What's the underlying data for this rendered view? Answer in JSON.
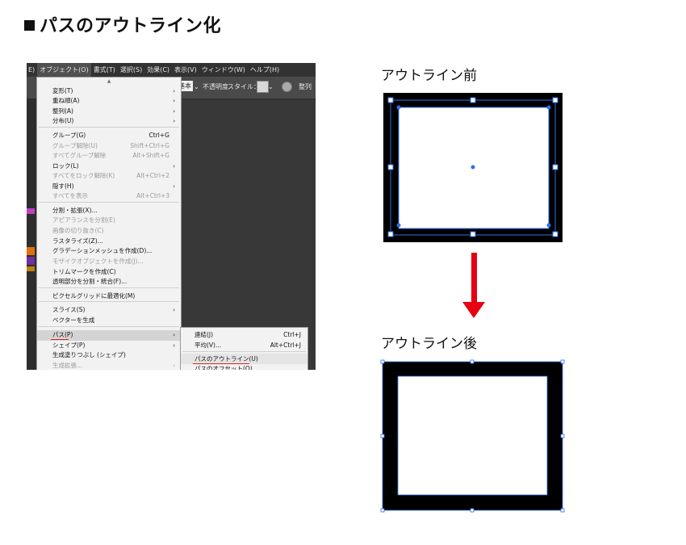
{
  "heading": "パスのアウトライン化",
  "screenshot": {
    "menubar": [
      "E)",
      "オブジェクト(O)",
      "書式(T)",
      "選択(S)",
      "効果(C)",
      "表示(V)",
      "ウィンドウ(W)",
      "ヘルプ(H)"
    ],
    "toolbar": {
      "basic": "基本",
      "opacity": "不透明度",
      "style": "スタイル：",
      "align": "整列"
    },
    "menu_items": [
      {
        "label": "変形(T)",
        "shortcut": "",
        "arrow": true,
        "disabled": false
      },
      {
        "label": "重ね順(A)",
        "shortcut": "",
        "arrow": true,
        "disabled": false
      },
      {
        "label": "整列(A)",
        "shortcut": "",
        "arrow": true,
        "disabled": false
      },
      {
        "label": "分布(U)",
        "shortcut": "",
        "arrow": true,
        "disabled": false
      },
      {
        "label": "グループ(G)",
        "shortcut": "Ctrl+G",
        "arrow": false,
        "disabled": false
      },
      {
        "label": "グループ解除(U)",
        "shortcut": "Shift+Ctrl+G",
        "arrow": false,
        "disabled": true
      },
      {
        "label": "すべてグループ解除",
        "shortcut": "Alt+Shift+G",
        "arrow": false,
        "disabled": true
      },
      {
        "label": "ロック(L)",
        "shortcut": "",
        "arrow": true,
        "disabled": false
      },
      {
        "label": "すべてをロック解除(K)",
        "shortcut": "Alt+Ctrl+2",
        "arrow": false,
        "disabled": true
      },
      {
        "label": "隠す(H)",
        "shortcut": "",
        "arrow": true,
        "disabled": false
      },
      {
        "label": "すべてを表示",
        "shortcut": "Alt+Ctrl+3",
        "arrow": false,
        "disabled": true
      },
      {
        "label": "分割・拡張(X)...",
        "shortcut": "",
        "arrow": false,
        "disabled": false
      },
      {
        "label": "アピアランスを分割(E)",
        "shortcut": "",
        "arrow": false,
        "disabled": true
      },
      {
        "label": "画像の切り抜き(C)",
        "shortcut": "",
        "arrow": false,
        "disabled": true
      },
      {
        "label": "ラスタライズ(Z)...",
        "shortcut": "",
        "arrow": false,
        "disabled": false
      },
      {
        "label": "グラデーションメッシュを作成(D)...",
        "shortcut": "",
        "arrow": false,
        "disabled": false
      },
      {
        "label": "モザイクオブジェクトを作成(J)...",
        "shortcut": "",
        "arrow": false,
        "disabled": true
      },
      {
        "label": "トリムマークを作成(C)",
        "shortcut": "",
        "arrow": false,
        "disabled": false
      },
      {
        "label": "透明部分を分割・統合(F)...",
        "shortcut": "",
        "arrow": false,
        "disabled": false
      },
      {
        "label": "ピクセルグリッドに最適化(M)",
        "shortcut": "",
        "arrow": false,
        "disabled": false
      },
      {
        "label": "スライス(S)",
        "shortcut": "",
        "arrow": true,
        "disabled": false
      },
      {
        "label": "ベクターを生成",
        "shortcut": "",
        "arrow": false,
        "disabled": false
      },
      {
        "label": "パス(P)",
        "shortcut": "",
        "arrow": true,
        "disabled": false
      },
      {
        "label": "シェイプ(P)",
        "shortcut": "",
        "arrow": true,
        "disabled": false
      },
      {
        "label": "生成塗りつぶし (シェイプ)",
        "shortcut": "",
        "arrow": false,
        "disabled": false
      },
      {
        "label": "生成拡張...",
        "shortcut": "",
        "arrow": true,
        "disabled": true
      }
    ],
    "submenu_items": [
      {
        "label": "連結(J)",
        "shortcut": "Ctrl+J"
      },
      {
        "label": "平均(V)...",
        "shortcut": "Alt+Ctrl+J"
      },
      {
        "label": "パスのアウトライン(U)",
        "shortcut": ""
      },
      {
        "label": "パスのオフセット(O)...",
        "shortcut": ""
      }
    ]
  },
  "before_label": "アウトライン前",
  "after_label": "アウトライン後",
  "colors": {
    "arrow": "#e60012",
    "selection": "#2f6fe8",
    "stroke": "#000000"
  }
}
